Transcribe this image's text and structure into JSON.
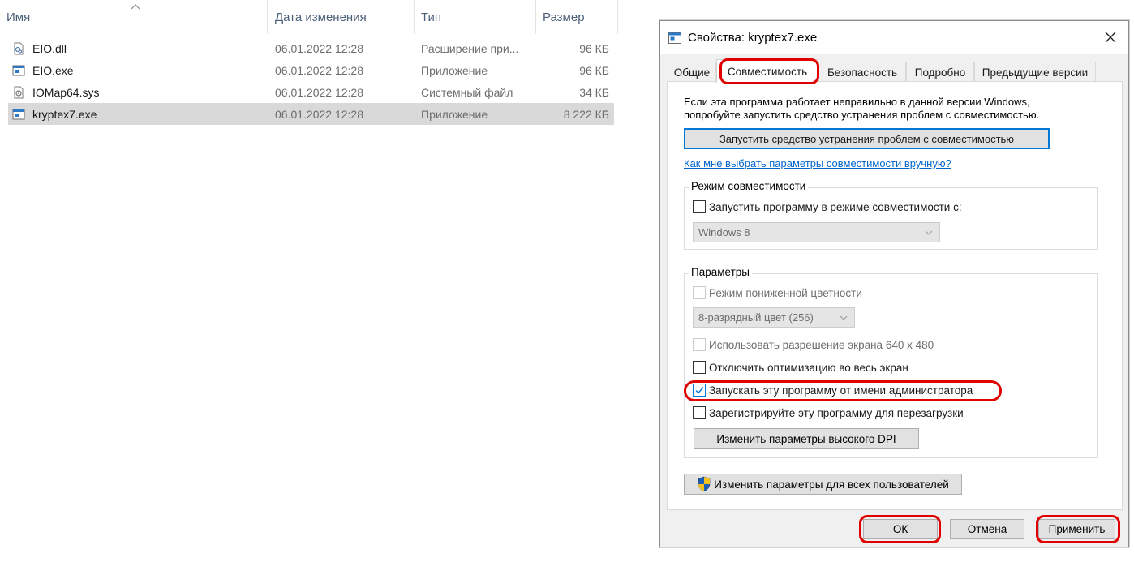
{
  "explorer": {
    "columns": {
      "name": "Имя",
      "date": "Дата изменения",
      "type": "Тип",
      "size": "Размер"
    },
    "files": [
      {
        "name": "EIO.dll",
        "date": "06.01.2022 12:28",
        "type": "Расширение при...",
        "size": "96 КБ",
        "icon": "dll-file-icon"
      },
      {
        "name": "EIO.exe",
        "date": "06.01.2022 12:28",
        "type": "Приложение",
        "size": "96 КБ",
        "icon": "exe-file-icon"
      },
      {
        "name": "IOMap64.sys",
        "date": "06.01.2022 12:28",
        "type": "Системный файл",
        "size": "34 КБ",
        "icon": "sys-file-icon"
      },
      {
        "name": "kryptex7.exe",
        "date": "06.01.2022 12:28",
        "type": "Приложение",
        "size": "8 222 КБ",
        "icon": "exe-file-icon"
      }
    ],
    "selected_index": 3
  },
  "dialog": {
    "title": "Свойства: kryptex7.exe",
    "tabs": [
      "Общие",
      "Совместимость",
      "Безопасность",
      "Подробно",
      "Предыдущие версии"
    ],
    "active_tab": "Совместимость",
    "intro_line1": "Если эта программа работает неправильно в данной версии Windows,",
    "intro_line2": "попробуйте запустить средство устранения проблем с совместимостью.",
    "troubleshoot_button": "Запустить средство устранения проблем с совместимостью",
    "help_link": "Как мне выбрать параметры совместимости вручную?",
    "compat_group": {
      "label": "Режим совместимости",
      "checkbox": "Запустить программу в режиме совместимости с:",
      "checked": false,
      "os_value": "Windows 8"
    },
    "params_group": {
      "label": "Параметры",
      "reduced_color": "Режим пониженной цветности",
      "color_value": "8-разрядный цвет (256)",
      "resolution": "Использовать разрешение экрана 640 x 480",
      "disable_fullscreen": "Отключить оптимизацию во весь экран",
      "run_as_admin": "Запускать эту программу от имени администратора",
      "run_as_admin_checked": true,
      "register_restart": "Зарегистрируйте эту программу для перезагрузки",
      "dpi_button": "Изменить параметры высокого DPI"
    },
    "all_users_button": "Изменить параметры для всех пользователей",
    "ok_button": "ОК",
    "cancel_button": "Отмена",
    "apply_button": "Применить"
  },
  "colors": {
    "annotation": "#e00000",
    "link": "#0066cc",
    "focus": "#0078d7",
    "selected_row": "#d9d9d9"
  }
}
